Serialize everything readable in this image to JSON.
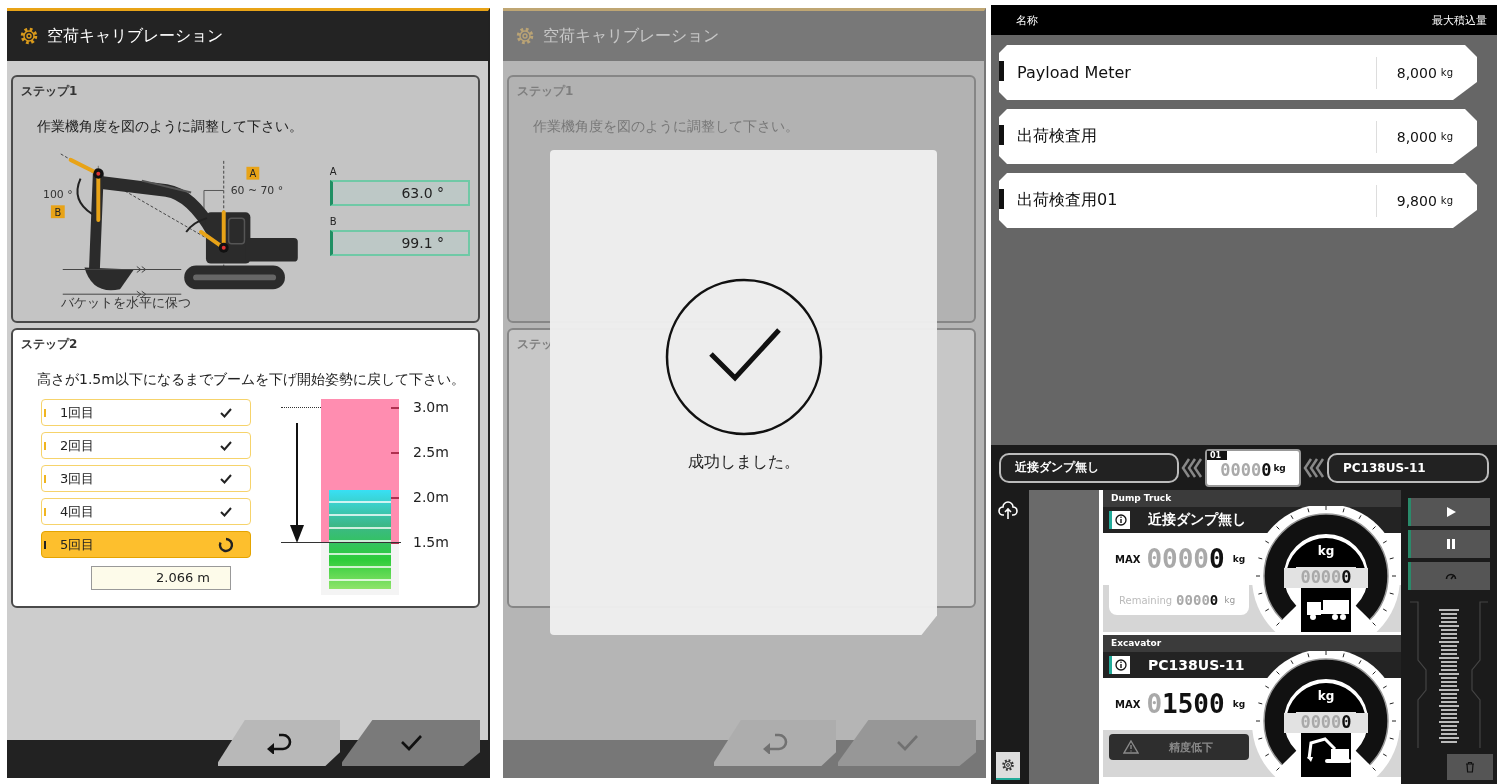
{
  "screens": [
    {
      "title": "空荷キャリブレーション",
      "step1": {
        "label": "ステップ1",
        "instruction": "作業機角度を図のように調整して下さい。",
        "diagram": {
          "boom_angle": "100 °",
          "badge_b": "B",
          "badge_a": "A",
          "body_angle": "60 ~ 70 °",
          "note": "バケットを水平に保つ"
        },
        "fields": [
          {
            "label": "A",
            "value": "63.0 °"
          },
          {
            "label": "B",
            "value": "99.1 °"
          }
        ]
      },
      "step2": {
        "label": "ステップ2",
        "instruction": "高さが1.5m以下になるまでブームを下げ開始姿勢に戻して下さい。",
        "attempts": [
          {
            "label": "1回目",
            "kind": "done",
            "selected": false
          },
          {
            "label": "2回目",
            "kind": "done",
            "selected": false
          },
          {
            "label": "3回目",
            "kind": "done",
            "selected": false
          },
          {
            "label": "4回目",
            "kind": "done",
            "selected": false
          },
          {
            "label": "5回目",
            "kind": "in_progress",
            "selected": true
          }
        ],
        "reading": "2.066 m",
        "meter": {
          "level": 0.52,
          "ticks": [
            "3.0m",
            "2.5m",
            "2.0m",
            "1.5m"
          ]
        }
      }
    },
    {
      "title": "空荷キャリブレーション",
      "step1": {
        "label": "ステップ1",
        "instruction": "作業機角度を図のように調整して下さい。"
      },
      "step2": {
        "label": "ステッ"
      },
      "dialog": {
        "message": "成功しました。"
      }
    }
  ],
  "payload_meter": {
    "columns": [
      "名称",
      "最大積込量"
    ],
    "items": [
      {
        "name": "Payload Meter",
        "value": "8,000",
        "unit": "kg"
      },
      {
        "name": "出荷検査用",
        "value": "8,000",
        "unit": "kg"
      },
      {
        "name": "出荷検査用01",
        "value": "9,800",
        "unit": "kg"
      }
    ],
    "status_bar": {
      "dump_truck": "近接ダンプ無し",
      "slot": "01",
      "total": {
        "ghost": "0000",
        "value": "0",
        "unit": "kg"
      },
      "excavator": "PC138US-11"
    },
    "cards": [
      {
        "kind": "dump_truck",
        "heading": "Dump Truck",
        "name": "近接ダンプ無し",
        "max_label": "MAX",
        "max": {
          "ghost": "0000",
          "value": "0",
          "unit": "kg"
        },
        "remaining": {
          "label": "Remaining",
          "ghost": "0000",
          "value": "0",
          "unit": "kg"
        },
        "gauge": {
          "unit": "kg",
          "ghost": "0000",
          "value": "0"
        }
      },
      {
        "kind": "excavator",
        "heading": "Excavator",
        "name": "PC138US-11",
        "max_label": "MAX",
        "max": {
          "ghost": "0",
          "value": "1500",
          "unit": "kg"
        },
        "warning": {
          "label": "精度低下",
          "disabled": true
        },
        "gauge": {
          "unit": "kg",
          "ghost": "0000",
          "value": "0"
        }
      }
    ]
  }
}
